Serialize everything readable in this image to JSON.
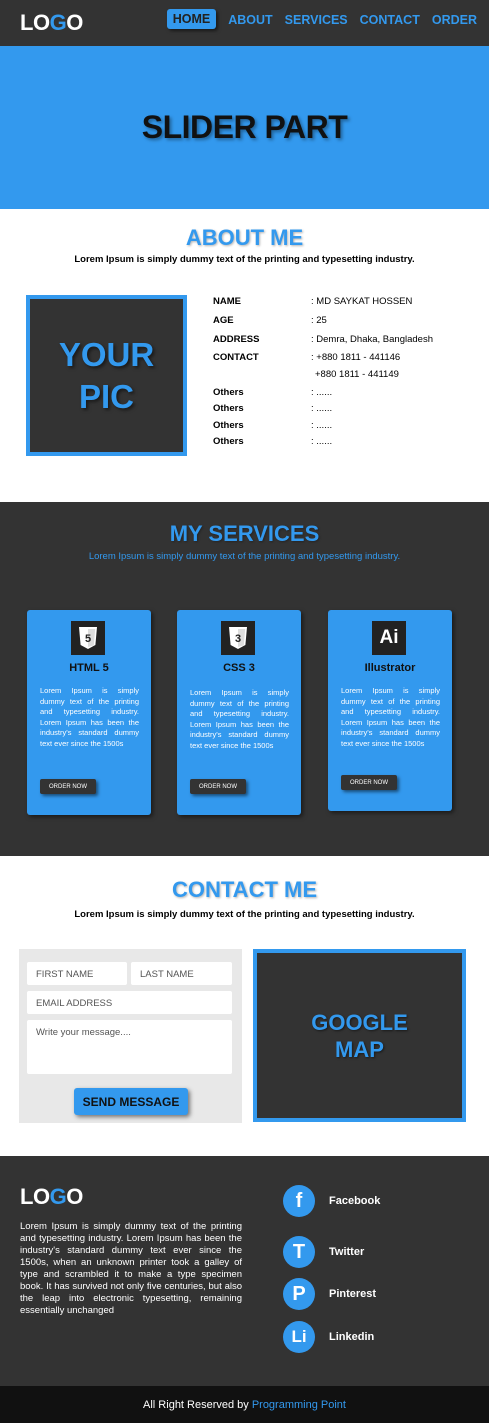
{
  "header": {
    "logo_prefix": "LO",
    "logo_g": "G",
    "logo_o": "O",
    "nav": [
      "HOME",
      "ABOUT",
      "SERVICES",
      "CONTACT",
      "ORDER"
    ]
  },
  "slider": {
    "title": "SLIDER PART"
  },
  "about": {
    "title": "ABOUT ME",
    "subtitle": "Lorem Ipsum is simply dummy text of the printing and typesetting industry.",
    "pic_line1": "YOUR",
    "pic_line2": "PIC",
    "rows": [
      {
        "key": "NAME",
        "value": ": MD SAYKAT HOSSEN"
      },
      {
        "key": "AGE",
        "value": ": 25"
      },
      {
        "key": "ADDRESS",
        "value": ": Demra, Dhaka, Bangladesh"
      },
      {
        "key": "CONTACT",
        "value": ": +880 1811 - 441146"
      },
      {
        "key": "",
        "value": "  +880 1811 - 441149"
      },
      {
        "key": "Others",
        "value": ": ......"
      },
      {
        "key": "Others",
        "value": ": ......"
      },
      {
        "key": "Others",
        "value": ": ......"
      },
      {
        "key": "Others",
        "value": ": ......"
      }
    ]
  },
  "services": {
    "title": "MY SERVICES",
    "subtitle": "Lorem Ipsum is simply dummy text of the printing and typesetting industry.",
    "cards": [
      {
        "icon": "5",
        "title": "HTML 5",
        "text": "Lorem Ipsum is simply dummy text of the printing and typesetting industry. Lorem Ipsum has been the industry's standard dummy text ever since the 1500s",
        "button": "ORDER NOW"
      },
      {
        "icon": "3",
        "title": "CSS 3",
        "text": "Lorem Ipsum is simply dummy text of the printing and typesetting industry. Lorem Ipsum has been the industry's standard dummy text ever since the 1500s",
        "button": "ORDER NOW"
      },
      {
        "icon": "Ai",
        "title": "Illustrator",
        "text": "Lorem Ipsum is simply dummy text of the printing and typesetting industry. Lorem Ipsum has been the industry's standard dummy text ever since the 1500s",
        "button": "ORDER NOW"
      }
    ]
  },
  "contact": {
    "title": "CONTACT  ME",
    "subtitle": "Lorem Ipsum is simply dummy text of the printing and typesetting industry.",
    "first_name": "FIRST NAME",
    "last_name": "LAST NAME",
    "email": "EMAIL ADDRESS",
    "message": "Write your message....",
    "send": "SEND MESSAGE",
    "map_line1": "GOOGLE",
    "map_line2": "MAP"
  },
  "footer": {
    "description": "Lorem Ipsum is simply dummy text of the printing and typesetting industry. Lorem Ipsum has been the industry's standard dummy text ever since the 1500s, when an unknown printer took a galley of type and scrambled it to make a type specimen book. It has survived not only five centuries, but also the leap into electronic typesetting, remaining essentially unchanged",
    "social": [
      {
        "icon": "f",
        "label": "Facebook"
      },
      {
        "icon": "T",
        "label": "Twitter"
      },
      {
        "icon": "P",
        "label": "Pinterest"
      },
      {
        "icon": "Li",
        "label": "Linkedin"
      }
    ],
    "copyright": "All Right Reserved by",
    "brand": "Programming Point"
  },
  "colors": {
    "accent": "#3399ee",
    "dark": "#333333"
  }
}
